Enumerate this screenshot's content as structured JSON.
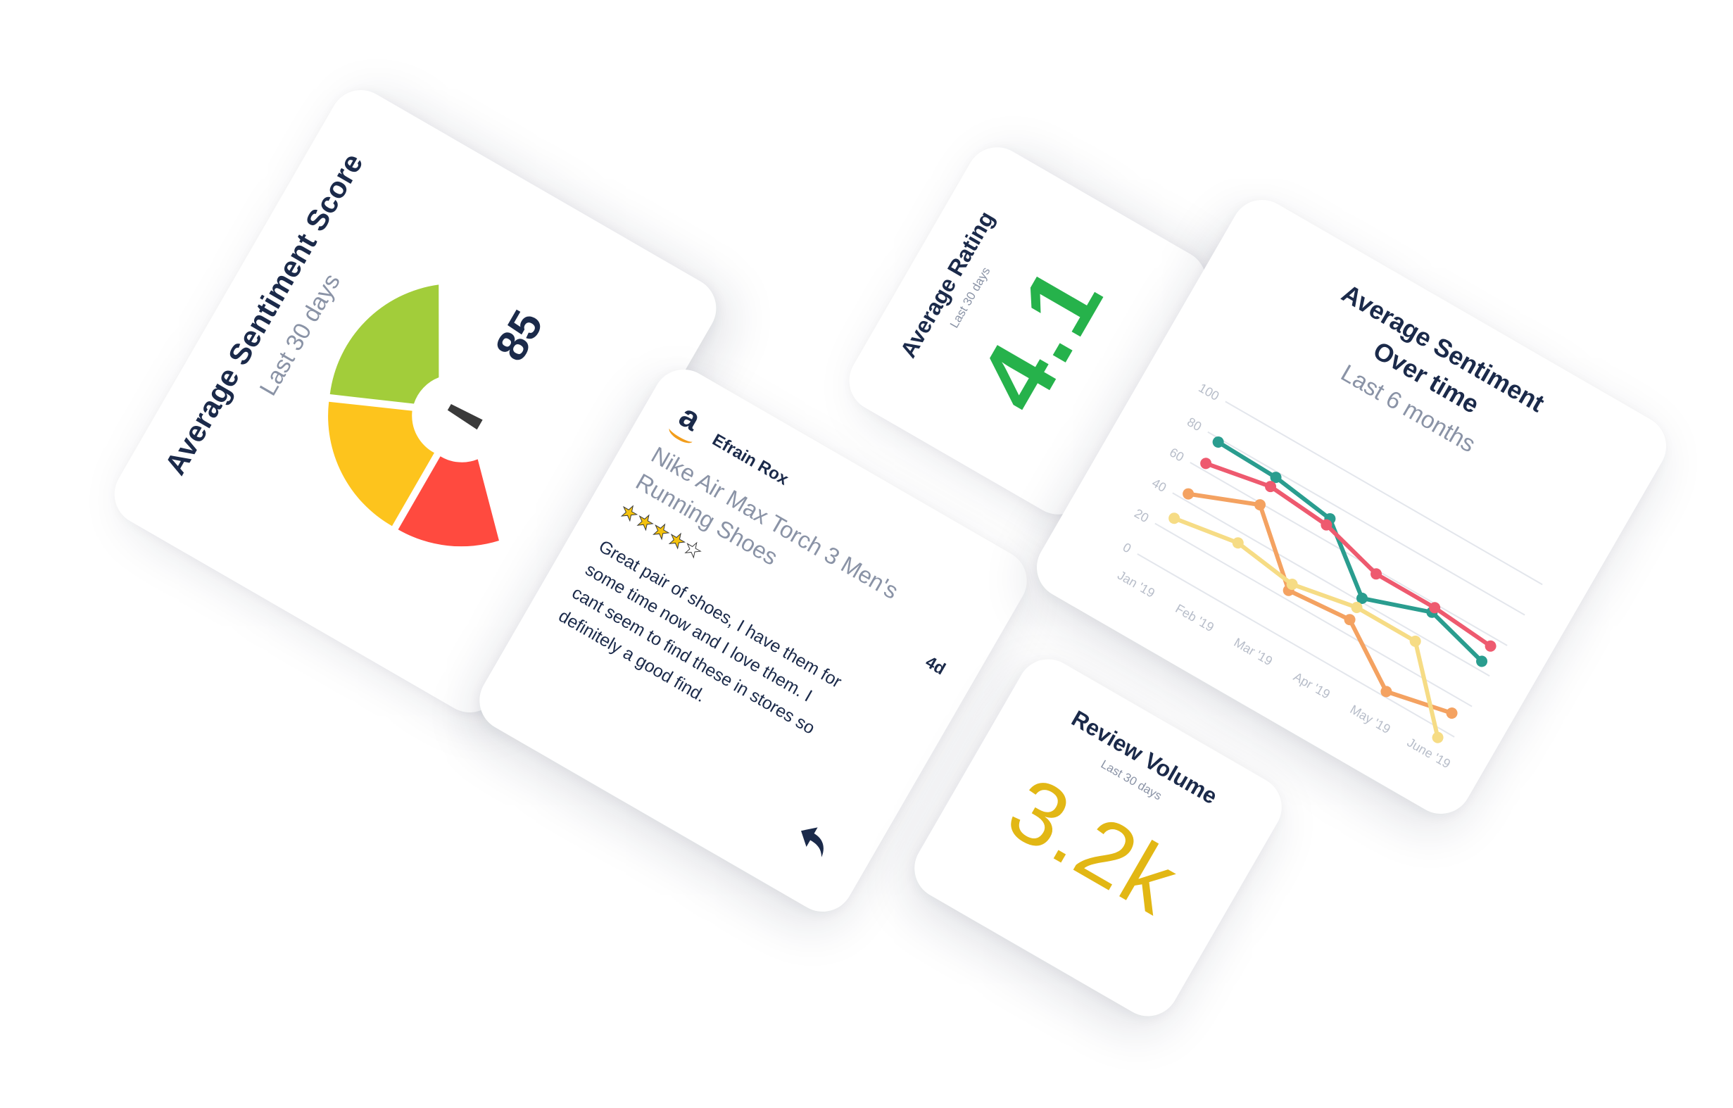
{
  "colors": {
    "navy": "#1b2a4a",
    "muted": "#8a93a6",
    "gauge_red": "#ff4a3f",
    "gauge_yellow": "#fdc41d",
    "gauge_green": "#a2cd3a",
    "needle": "#3a3a3a",
    "rating_green": "#26b24b",
    "volume_gold": "#e2b714"
  },
  "sentiment_score": {
    "title": "Average Sentiment Score",
    "subtitle": "Last 30 days",
    "value": "85",
    "gauge_value": 85,
    "gauge_max": 100
  },
  "review": {
    "source_icon": "amazon-logo-icon",
    "logo_letter": "a",
    "author": "Efrain Rox",
    "product": "Nike Air Max Torch 3 Men's Running Shoes",
    "rating": 4,
    "rating_max": 5,
    "age": "4d",
    "body": "Great pair of shoes, I have them for some time now and I love them. I cant seem to find these in stores so definitely a good find.",
    "reply_icon": "reply-arrow-icon"
  },
  "average_rating": {
    "title": "Average Rating",
    "subtitle": "Last 30 days",
    "value": "4.1"
  },
  "review_volume": {
    "title": "Review Volume",
    "subtitle": "Last 30 days",
    "value": "3.2k"
  },
  "sentiment_trend": {
    "title_line1": "Average Sentiment",
    "title_line2": "Over time",
    "subtitle": "Last 6 months"
  },
  "chart_data": {
    "type": "line",
    "categories": [
      "Jan '19",
      "Feb '19",
      "Mar '19",
      "Apr '19",
      "May '19",
      "June '19"
    ],
    "yticks": [
      "100",
      "80",
      "60",
      "40",
      "20",
      "0"
    ],
    "ylim": [
      0,
      100
    ],
    "grid": true,
    "series": [
      {
        "color": "#2a9d8f",
        "values": [
          78,
          77,
          72,
          42,
          55,
          45
        ]
      },
      {
        "color": "#ee5a6f",
        "values": [
          64,
          71,
          68,
          58,
          58,
          55
        ]
      },
      {
        "color": "#f4a261",
        "values": [
          44,
          59,
          25,
          28,
          3,
          11
        ]
      },
      {
        "color": "#f6dc85",
        "values": [
          28,
          34,
          29,
          36,
          36,
          -5
        ]
      }
    ]
  }
}
